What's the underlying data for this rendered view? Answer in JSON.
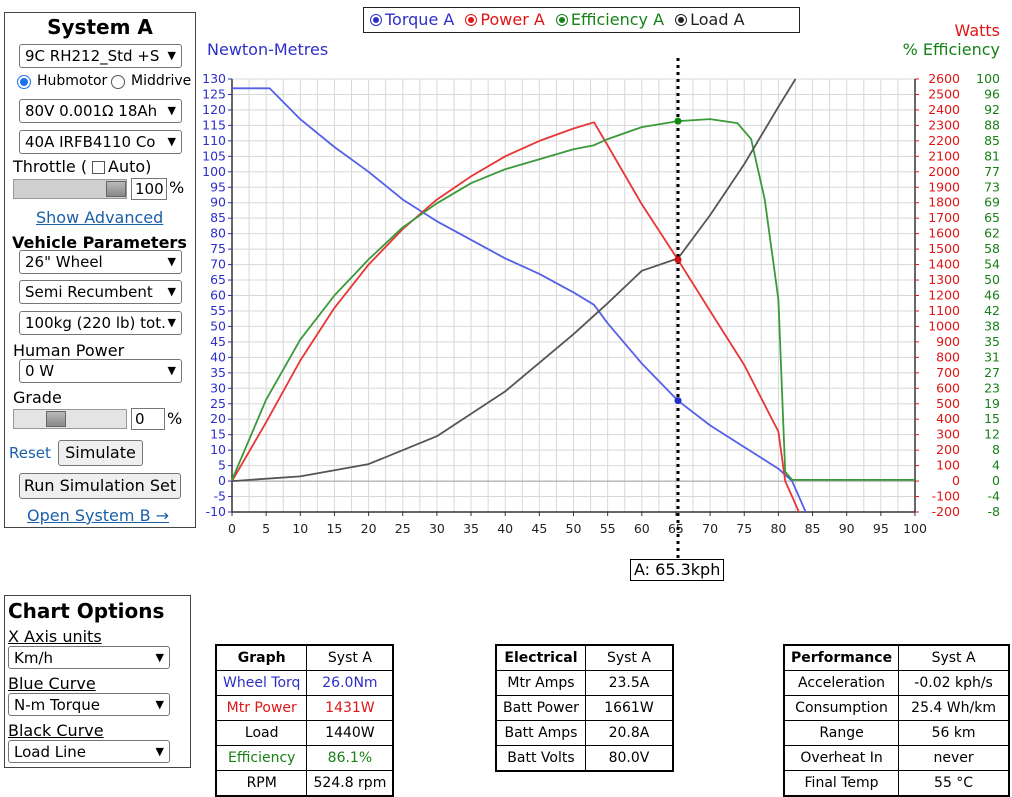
{
  "system_panel": {
    "title": "System A",
    "motor_select": "9C RH212_Std +S",
    "hubmotor_label": "Hubmotor",
    "middrive_label": "Middrive",
    "battery_select": "80V 0.001Ω 18Ah",
    "controller_select": "40A IRFB4110 Co",
    "throttle_label": "Throttle (",
    "auto_label": "Auto)",
    "throttle_value": "100",
    "throttle_unit": "%",
    "throttle_level": 1.0,
    "show_advanced": "Show Advanced",
    "vehicle_params_title": "Vehicle Parameters",
    "wheel_select": "26\"  Wheel",
    "posture_select": "Semi Recumbent",
    "weight_select": "100kg (220 lb) tot.",
    "human_power_label": "Human Power",
    "human_power_select": "0 W",
    "grade_label": "Grade",
    "grade_value": "0",
    "grade_unit": "%",
    "reset_label": "Reset",
    "simulate_label": "Simulate",
    "run_set_label": "Run Simulation Set",
    "open_system_b": "Open System B →"
  },
  "chart_options": {
    "title": "Chart Options",
    "x_axis_label": "X Axis units",
    "x_axis_select": "Km/h",
    "blue_label": "Blue Curve",
    "blue_select": "N-m Torque",
    "black_label": "Black Curve",
    "black_select": "Load Line"
  },
  "legend": {
    "torque": "Torque A",
    "power": "Power A",
    "efficiency": "Efficiency A",
    "load": "Load A"
  },
  "colors": {
    "torque": "#5560e8",
    "power": "#e83535",
    "efficiency": "#3a9a3a",
    "load": "#555555",
    "blue_text": "#2d2fc8",
    "red_text": "#e01515",
    "green_text": "#178017"
  },
  "speed_marker": "A: 65.3kph",
  "chart_data": {
    "type": "line",
    "ylabel_left": "Newton-Metres",
    "ylabel_right_1": "Watts",
    "ylabel_right_2": "% Efficiency",
    "xlim": [
      0,
      100
    ],
    "ylim_left": [
      -10,
      130
    ],
    "ylim_watts": [
      -200,
      2600
    ],
    "ylim_eff": [
      -8,
      100
    ],
    "x_ticks": [
      0,
      5,
      10,
      15,
      20,
      25,
      30,
      35,
      40,
      45,
      50,
      55,
      60,
      65,
      70,
      75,
      80,
      85,
      90,
      95,
      100
    ],
    "y_ticks_left": [
      130,
      125,
      120,
      115,
      110,
      105,
      100,
      95,
      90,
      85,
      80,
      75,
      70,
      65,
      60,
      55,
      50,
      45,
      40,
      35,
      30,
      25,
      20,
      15,
      10,
      5,
      0,
      -5,
      -10
    ],
    "y_ticks_watts": [
      2600,
      2500,
      2400,
      2300,
      2200,
      2100,
      2000,
      1900,
      1800,
      1700,
      1600,
      1500,
      1400,
      1300,
      1200,
      1100,
      1000,
      900,
      800,
      700,
      600,
      500,
      400,
      300,
      200,
      100,
      0,
      -100,
      -200
    ],
    "y_ticks_eff": [
      100,
      96,
      92,
      88,
      85,
      81,
      77,
      73,
      69,
      65,
      62,
      58,
      54,
      50,
      46,
      42,
      38,
      35,
      31,
      27,
      23,
      19,
      15,
      12,
      8,
      4,
      0,
      -4,
      -8
    ],
    "marker_x": 65.3,
    "series": [
      {
        "name": "Torque A",
        "axis": "nm",
        "points": [
          [
            0,
            127
          ],
          [
            5.5,
            127
          ],
          [
            10,
            117
          ],
          [
            15,
            108
          ],
          [
            20,
            100
          ],
          [
            25,
            91
          ],
          [
            30,
            84
          ],
          [
            35,
            78
          ],
          [
            40,
            72
          ],
          [
            45,
            67
          ],
          [
            50,
            61
          ],
          [
            53,
            57
          ],
          [
            55,
            51
          ],
          [
            60,
            38
          ],
          [
            65.3,
            26
          ],
          [
            70,
            18
          ],
          [
            75,
            11
          ],
          [
            80,
            4
          ],
          [
            82,
            0
          ],
          [
            83,
            -5
          ],
          [
            84,
            -10
          ]
        ]
      },
      {
        "name": "Power A",
        "axis": "watts",
        "points": [
          [
            0,
            0
          ],
          [
            5,
            380
          ],
          [
            10,
            780
          ],
          [
            15,
            1120
          ],
          [
            20,
            1400
          ],
          [
            25,
            1630
          ],
          [
            30,
            1820
          ],
          [
            35,
            1970
          ],
          [
            40,
            2100
          ],
          [
            45,
            2200
          ],
          [
            50,
            2280
          ],
          [
            53,
            2320
          ],
          [
            55,
            2170
          ],
          [
            60,
            1790
          ],
          [
            65.3,
            1431
          ],
          [
            70,
            1100
          ],
          [
            75,
            750
          ],
          [
            80,
            320
          ],
          [
            81,
            0
          ],
          [
            82,
            -100
          ],
          [
            83,
            -200
          ]
        ]
      },
      {
        "name": "Efficiency A",
        "axis": "eff",
        "points": [
          [
            0,
            0
          ],
          [
            5,
            20
          ],
          [
            10,
            35
          ],
          [
            15,
            46
          ],
          [
            20,
            55
          ],
          [
            25,
            63
          ],
          [
            30,
            69
          ],
          [
            35,
            74
          ],
          [
            40,
            77.5
          ],
          [
            45,
            80
          ],
          [
            50,
            82.5
          ],
          [
            53,
            83.5
          ],
          [
            55,
            85
          ],
          [
            60,
            88
          ],
          [
            65.3,
            89.5
          ],
          [
            70,
            90
          ],
          [
            74,
            89
          ],
          [
            76,
            85
          ],
          [
            78,
            70
          ],
          [
            80,
            45
          ],
          [
            81,
            2
          ],
          [
            82,
            0
          ],
          [
            100,
            0
          ]
        ]
      },
      {
        "name": "Load A",
        "axis": "watts",
        "points": [
          [
            0,
            0
          ],
          [
            10,
            30
          ],
          [
            20,
            110
          ],
          [
            30,
            290
          ],
          [
            40,
            580
          ],
          [
            50,
            950
          ],
          [
            55,
            1150
          ],
          [
            60,
            1360
          ],
          [
            65.3,
            1440
          ],
          [
            70,
            1720
          ],
          [
            75,
            2050
          ],
          [
            80,
            2420
          ],
          [
            82.5,
            2600
          ]
        ]
      }
    ],
    "marker_dots": [
      {
        "axis": "nm",
        "x": 65.3,
        "y": 26
      },
      {
        "axis": "watts",
        "x": 65.3,
        "y": 1431
      },
      {
        "axis": "eff",
        "x": 65.3,
        "y": 89.5
      }
    ]
  },
  "tables": {
    "graph": {
      "headers": [
        "Graph",
        "Syst A"
      ],
      "rows": [
        [
          "Wheel Torq",
          "26.0Nm",
          "blue"
        ],
        [
          "Mtr Power",
          "1431W",
          "red"
        ],
        [
          "Load",
          "1440W",
          "black"
        ],
        [
          "Efficiency",
          "86.1%",
          "green"
        ],
        [
          "RPM",
          "524.8 rpm",
          "black"
        ]
      ]
    },
    "electrical": {
      "headers": [
        "Electrical",
        "Syst A"
      ],
      "rows": [
        [
          "Mtr Amps",
          "23.5A"
        ],
        [
          "Batt Power",
          "1661W"
        ],
        [
          "Batt Amps",
          "20.8A"
        ],
        [
          "Batt Volts",
          "80.0V"
        ]
      ]
    },
    "performance": {
      "headers": [
        "Performance",
        "Syst A"
      ],
      "rows": [
        [
          "Acceleration",
          "-0.02 kph/s"
        ],
        [
          "Consumption",
          "25.4 Wh/km"
        ],
        [
          "Range",
          "56 km"
        ],
        [
          "Overheat In",
          "never"
        ],
        [
          "Final Temp",
          "55 °C"
        ]
      ]
    }
  }
}
